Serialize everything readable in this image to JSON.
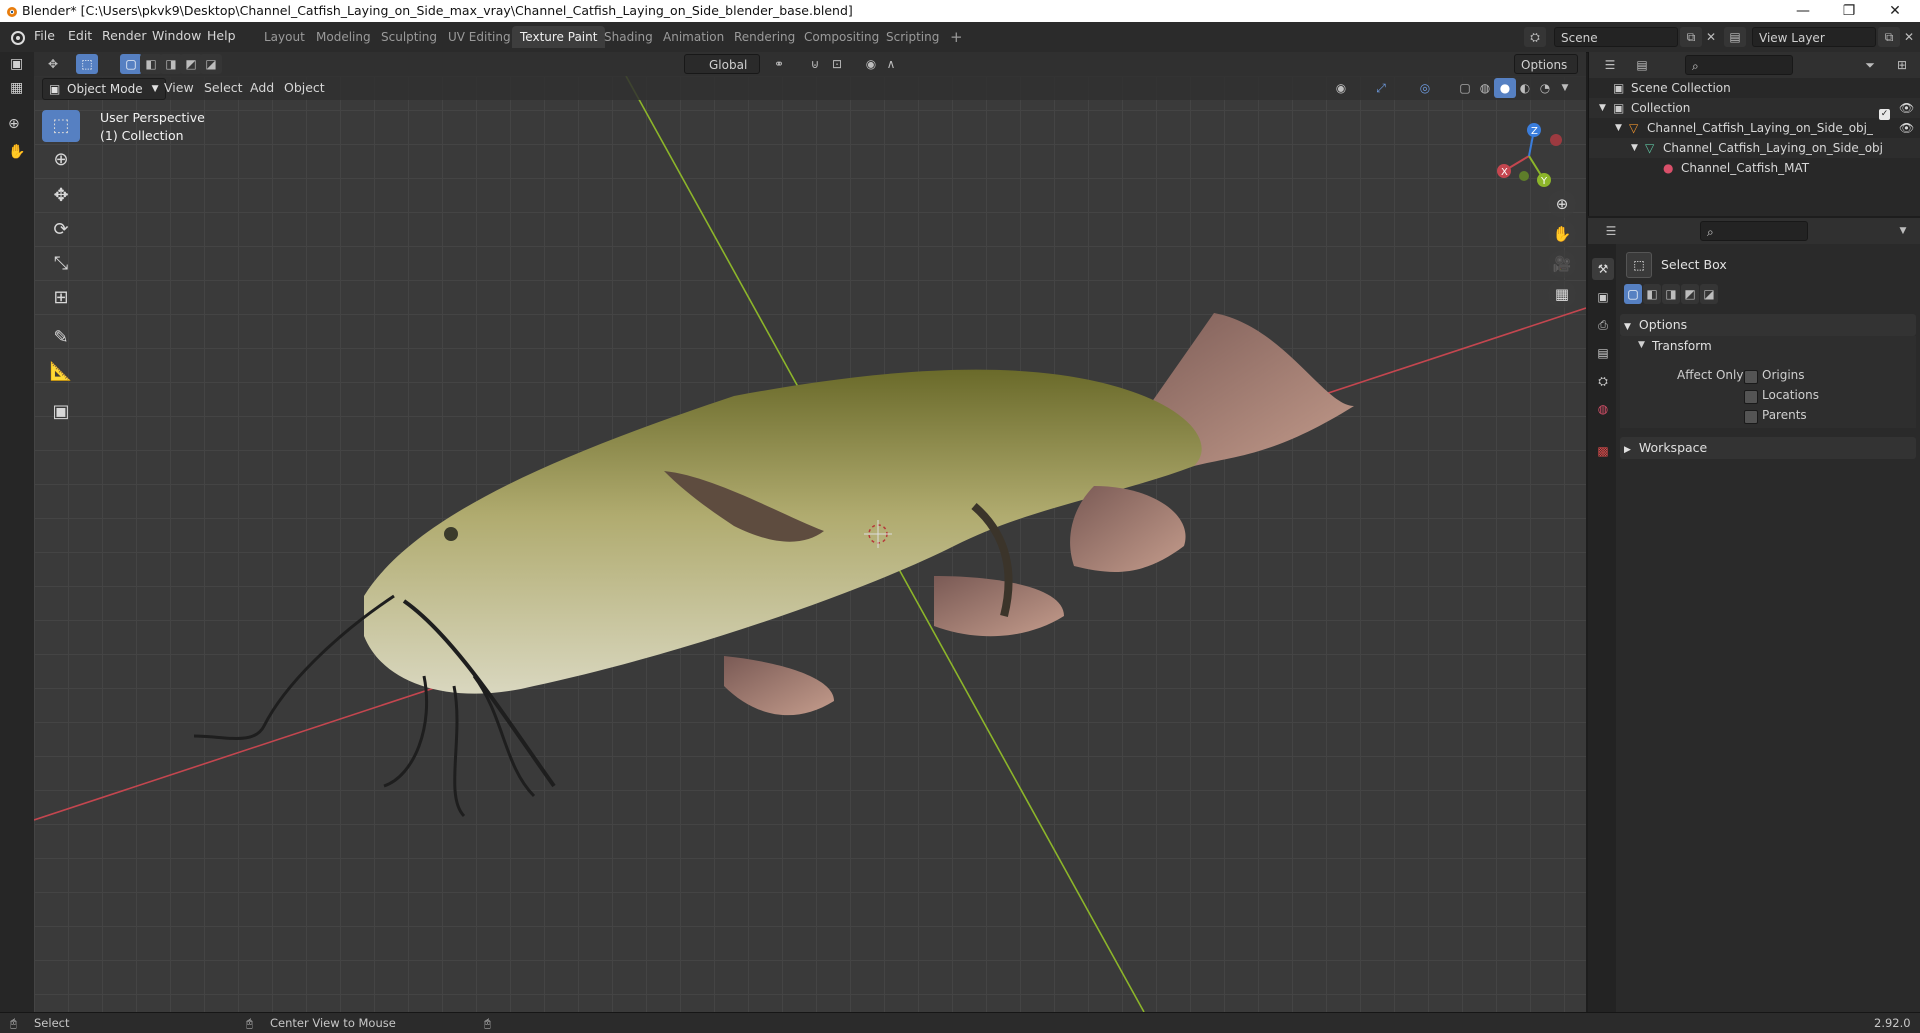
{
  "window": {
    "title": "Blender* [C:\\Users\\pkvk9\\Desktop\\Channel_Catfish_Laying_on_Side_max_vray\\Channel_Catfish_Laying_on_Side_blender_base.blend]",
    "minimize": "—",
    "maximize": "❐",
    "close": "✕"
  },
  "menu": {
    "file": "File",
    "edit": "Edit",
    "render": "Render",
    "window": "Window",
    "help": "Help"
  },
  "workspaces": [
    {
      "label": "Layout",
      "active": false
    },
    {
      "label": "Modeling",
      "active": false
    },
    {
      "label": "Sculpting",
      "active": false
    },
    {
      "label": "UV Editing",
      "active": false
    },
    {
      "label": "Texture Paint",
      "active": true
    },
    {
      "label": "Shading",
      "active": false
    },
    {
      "label": "Animation",
      "active": false
    },
    {
      "label": "Rendering",
      "active": false
    },
    {
      "label": "Compositing",
      "active": false
    },
    {
      "label": "Scripting",
      "active": false
    }
  ],
  "add_workspace": "+",
  "scene": {
    "scene_name": "Scene",
    "view_layer": "View Layer"
  },
  "viewport_header": {
    "transform_orientation": "Global",
    "options": "Options",
    "mode": "Object Mode",
    "view": "View",
    "select": "Select",
    "add": "Add",
    "object": "Object"
  },
  "viewport_overlay": {
    "perspective": "User Perspective",
    "collection": "(1) Collection"
  },
  "gizmo": {
    "x": "X",
    "y": "Y",
    "z": "Z"
  },
  "outliner": {
    "items": [
      {
        "label": "Scene Collection"
      },
      {
        "label": "Collection"
      },
      {
        "label": "Channel_Catfish_Laying_on_Side_obj_bas"
      },
      {
        "label": "Channel_Catfish_Laying_on_Side_obj"
      },
      {
        "label": "Channel_Catfish_MAT"
      }
    ]
  },
  "properties": {
    "tool_name": "Select Box",
    "options_panel": "Options",
    "transform_panel": "Transform",
    "affect_only": "Affect Only",
    "origins": "Origins",
    "locations": "Locations",
    "parents": "Parents",
    "workspace_panel": "Workspace"
  },
  "status": {
    "select": "Select",
    "center_view": "Center View to Mouse",
    "version": "2.92.0"
  },
  "colors": {
    "accent_blue": "#5680c2",
    "axis_red": "#c4464f",
    "axis_green": "#8cb52a",
    "gizmo_blue": "#3a7ddc"
  }
}
